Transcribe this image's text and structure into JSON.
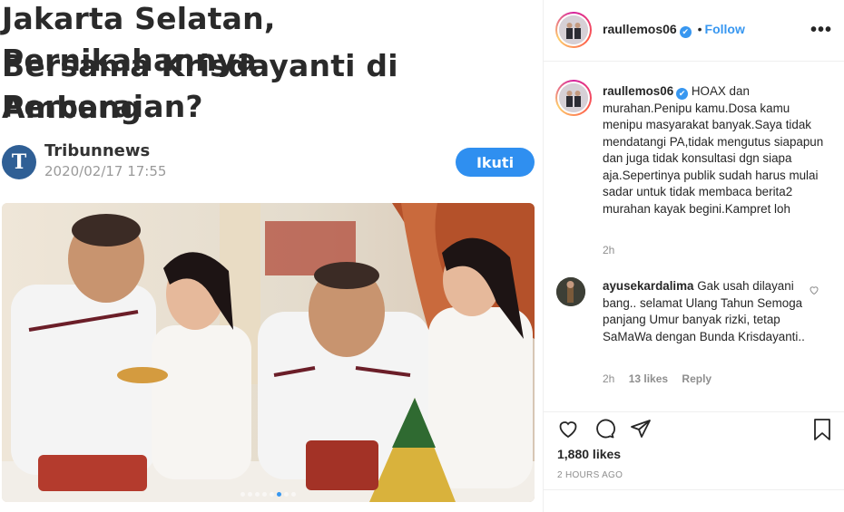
{
  "article": {
    "headline_line1": "Jakarta Selatan, Pernikahannya",
    "headline_line2": "Bersama Krisdayanti di Ambang",
    "headline_line3": "Perceraian?",
    "source_name": "Tribunnews",
    "source_logo_letter": "T",
    "date": "2020/02/17 17:55",
    "follow_label": "Ikuti",
    "carousel_count": 8,
    "carousel_active": 5
  },
  "post": {
    "username": "raullemos06",
    "verified_mark": "✔",
    "follow_separator": "•",
    "follow_label": "Follow",
    "more_icon": "•••"
  },
  "caption": {
    "username": "raullemos06",
    "text": "HOAX dan murahan.Penipu kamu.Dosa kamu menipu masyarakat banyak.Saya tidak mendatangi PA,tidak mengutus siapapun dan juga tidak konsultasi dgn siapa aja.Sepertinya publik sudah harus mulai sadar untuk tidak membaca berita2 murahan kayak begini.Kampret loh",
    "time": "2h"
  },
  "comments": [
    {
      "username": "ayusekardalima",
      "text": "Gak usah dilayani bang.. selamat Ulang Tahun Semoga panjang Umur banyak rizki, tetap SaMaWa dengan Bunda Krisdayanti..",
      "time": "2h",
      "likes": "13 likes",
      "reply": "Reply"
    }
  ],
  "stats": {
    "likes": "1,880 likes",
    "ago": "2 HOURS AGO"
  },
  "colors": {
    "accent": "#3897f0",
    "ikuti_button": "#2f8ff0",
    "tribun_logo": "#2f5f95"
  }
}
